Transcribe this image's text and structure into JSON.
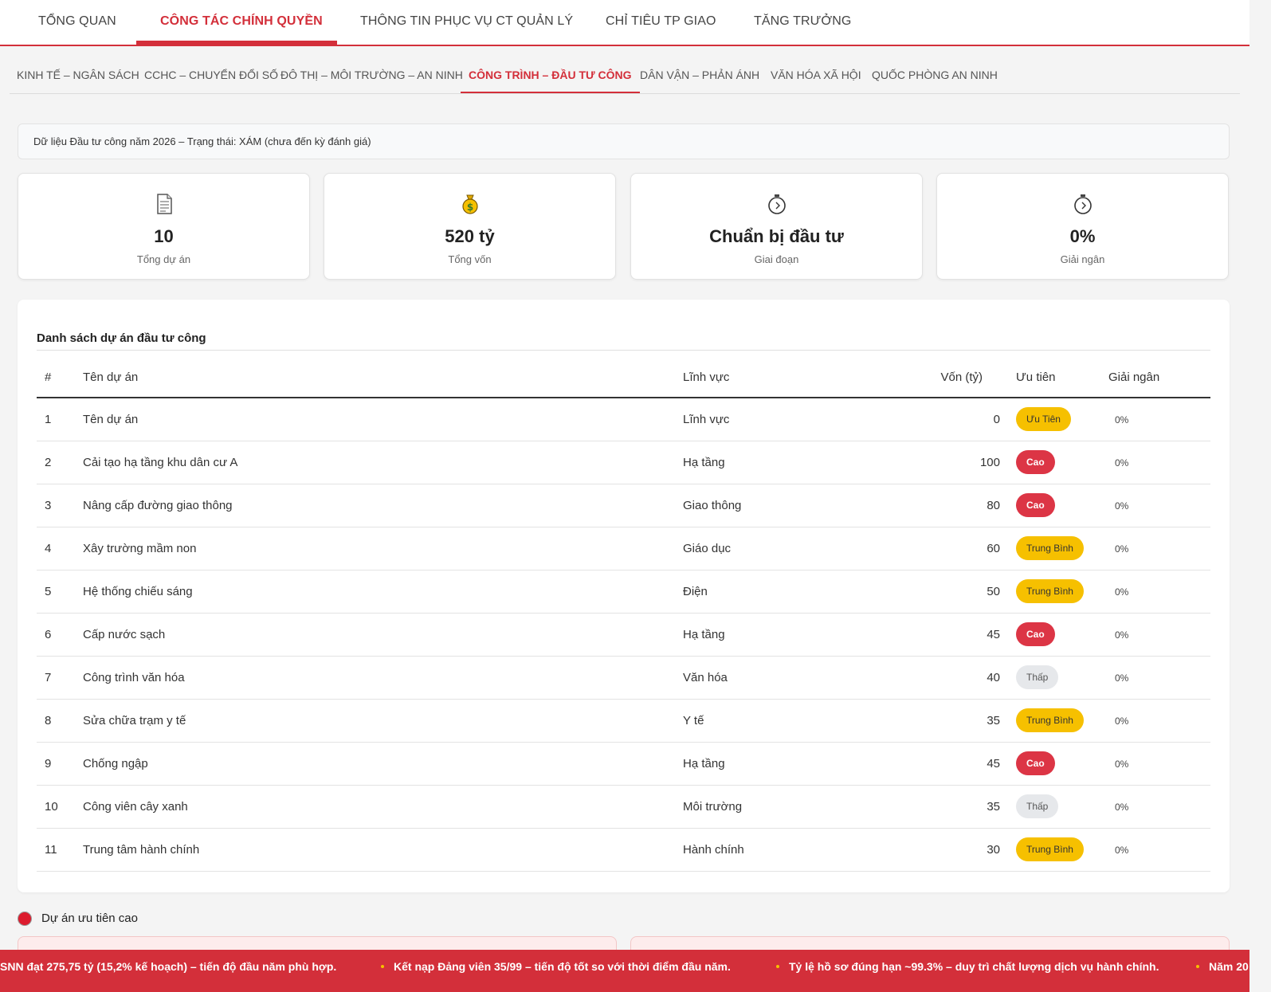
{
  "top_nav": {
    "items": [
      {
        "label": "TỔNG QUAN"
      },
      {
        "label": "CÔNG TÁC CHÍNH QUYỀN"
      },
      {
        "label": "THÔNG TIN PHỤC VỤ CT QUẢN LÝ"
      },
      {
        "label": "CHỈ TIÊU TP GIAO"
      },
      {
        "label": "TĂNG TRƯỞNG"
      }
    ],
    "active_index": 1
  },
  "sub_nav": {
    "items": [
      {
        "label": "KINH TẾ – NGÂN SÁCH"
      },
      {
        "label": "CCHC – CHUYỂN ĐỔI SỐ"
      },
      {
        "label": "ĐÔ THỊ – MÔI TRƯỜNG – AN NINH"
      },
      {
        "label": "CÔNG TRÌNH – ĐẦU TƯ CÔNG"
      },
      {
        "label": "DÂN VẬN – PHẢN ÁNH"
      },
      {
        "label": "VĂN HÓA XÃ HỘI"
      },
      {
        "label": "QUỐC PHÒNG AN NINH"
      }
    ],
    "active_index": 3
  },
  "notice": {
    "text": "Dữ liệu Đầu tư công năm 2026 – Trạng thái: XÁM (chưa đến kỳ đánh giá)"
  },
  "kpis": [
    {
      "icon": "document-icon",
      "value": "10",
      "label": "Tổng dự án"
    },
    {
      "icon": "money-bag-icon",
      "value": "520 tỷ",
      "label": "Tổng vốn"
    },
    {
      "icon": "stopwatch-icon",
      "value": "Chuẩn bị đầu tư",
      "label": "Giai đoạn"
    },
    {
      "icon": "stopwatch-icon",
      "value": "0%",
      "label": "Giải ngân"
    }
  ],
  "project_table": {
    "title": "Danh sách dự án đầu tư công",
    "headers": {
      "num": "#",
      "name": "Tên dự án",
      "field": "Lĩnh vực",
      "capital": "Vốn (tỷ)",
      "priority": "Ưu tiên",
      "disbursement": "Giải ngân"
    },
    "rows": [
      {
        "num": "1",
        "name": "Tên dự án",
        "field": "Lĩnh vực",
        "capital": "0",
        "priority": "Ưu Tiên",
        "level": "mid",
        "disbursement": "0%"
      },
      {
        "num": "2",
        "name": "Cải tạo hạ tầng khu dân cư A",
        "field": "Hạ tầng",
        "capital": "100",
        "priority": "Cao",
        "level": "high",
        "disbursement": "0%"
      },
      {
        "num": "3",
        "name": "Nâng cấp đường giao thông",
        "field": "Giao thông",
        "capital": "80",
        "priority": "Cao",
        "level": "high",
        "disbursement": "0%"
      },
      {
        "num": "4",
        "name": "Xây trường mầm non",
        "field": "Giáo dục",
        "capital": "60",
        "priority": "Trung Bình",
        "level": "mid",
        "disbursement": "0%"
      },
      {
        "num": "5",
        "name": "Hệ thống chiếu sáng",
        "field": "Điện",
        "capital": "50",
        "priority": "Trung Bình",
        "level": "mid",
        "disbursement": "0%"
      },
      {
        "num": "6",
        "name": "Cấp nước sạch",
        "field": "Hạ tầng",
        "capital": "45",
        "priority": "Cao",
        "level": "high",
        "disbursement": "0%"
      },
      {
        "num": "7",
        "name": "Công trình văn hóa",
        "field": "Văn hóa",
        "capital": "40",
        "priority": "Thấp",
        "level": "low",
        "disbursement": "0%"
      },
      {
        "num": "8",
        "name": "Sửa chữa trạm y tế",
        "field": "Y tế",
        "capital": "35",
        "priority": "Trung Bình",
        "level": "mid",
        "disbursement": "0%"
      },
      {
        "num": "9",
        "name": "Chống ngập",
        "field": "Hạ tầng",
        "capital": "45",
        "priority": "Cao",
        "level": "high",
        "disbursement": "0%"
      },
      {
        "num": "10",
        "name": "Công viên cây xanh",
        "field": "Môi trường",
        "capital": "35",
        "priority": "Thấp",
        "level": "low",
        "disbursement": "0%"
      },
      {
        "num": "11",
        "name": "Trung tâm hành chính",
        "field": "Hành chính",
        "capital": "30",
        "priority": "Trung Bình",
        "level": "mid",
        "disbursement": "0%"
      }
    ]
  },
  "priority_section": {
    "title": "Dự án ưu tiên cao"
  },
  "ticker": {
    "items": [
      "SNN đạt 275,75 tỷ (15,2% kế hoạch) – tiến độ đầu năm phù hợp.",
      "Kết nạp Đảng viên 35/99 – tiến độ tốt so với thời điểm đầu năm.",
      "Tỷ lệ hồ sơ đúng hạn ~99.3% – duy trì chất lượng dịch vụ hành chính.",
      "Năm 20"
    ]
  },
  "colors": {
    "accent": "#d32f3a",
    "high": "#dc3545",
    "mid": "#f6c000",
    "low": "#e6e8eb"
  }
}
